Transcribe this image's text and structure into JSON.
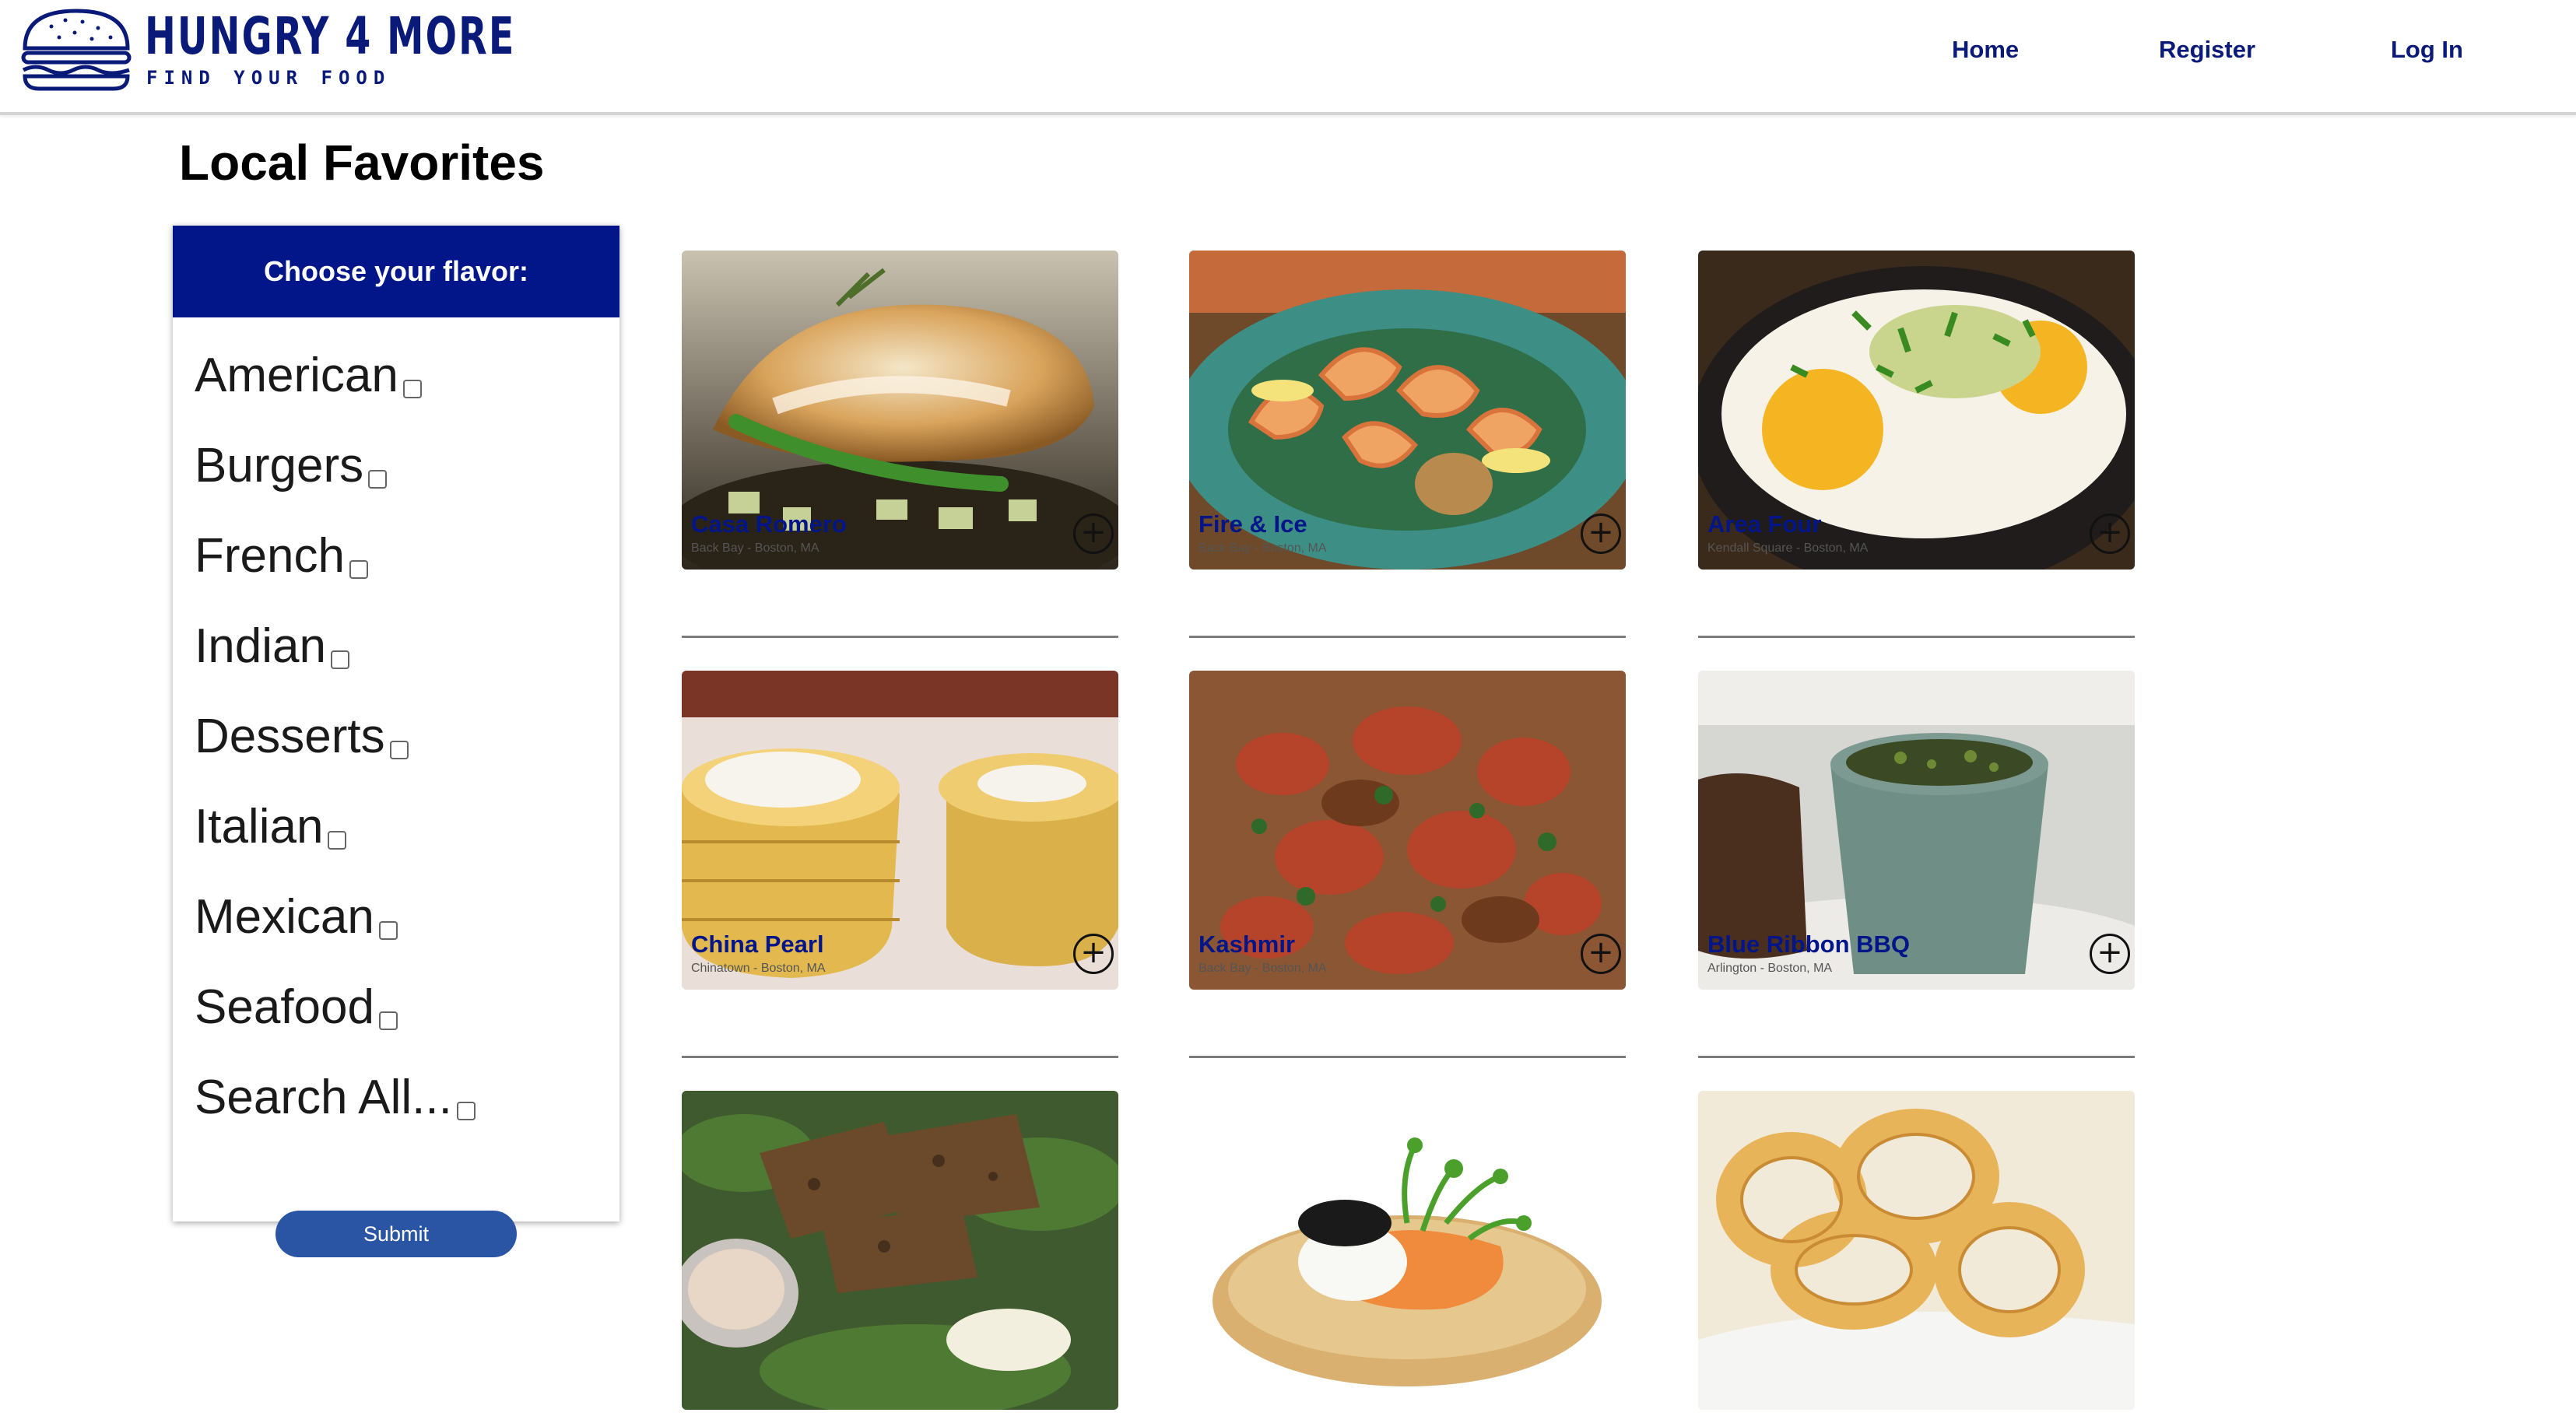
{
  "brand": {
    "title": "HUNGRY 4 MORE",
    "subtitle": "FIND YOUR FOOD",
    "icon": "burger-icon",
    "color": "#0a1a78"
  },
  "nav": {
    "home": "Home",
    "register": "Register",
    "login": "Log In"
  },
  "page": {
    "title": "Local Favorites"
  },
  "filter": {
    "heading": "Choose your flavor:",
    "options": [
      {
        "label": "American",
        "checked": false
      },
      {
        "label": "Burgers",
        "checked": false
      },
      {
        "label": "French",
        "checked": false
      },
      {
        "label": "Indian",
        "checked": false
      },
      {
        "label": "Desserts",
        "checked": false
      },
      {
        "label": "Italian",
        "checked": false
      },
      {
        "label": "Mexican",
        "checked": false
      },
      {
        "label": "Seafood",
        "checked": false
      },
      {
        "label": "Search All...",
        "checked": false
      }
    ],
    "submit": "Submit",
    "header_color": "#02168a",
    "button_color": "#2a55a4"
  },
  "restaurants": [
    {
      "name": "Casa Romero",
      "location": "Back Bay - Boston, MA",
      "photo": "stuffed-chicken-photo",
      "add_icon": "plus-circle-icon"
    },
    {
      "name": "Fire & Ice",
      "location": "Back Bay - Boston, MA",
      "photo": "shrimp-plate-photo",
      "add_icon": "plus-circle-icon"
    },
    {
      "name": "Area Four",
      "location": "Kendall Square - Boston, MA",
      "photo": "eggs-skillet-photo",
      "add_icon": "plus-circle-icon"
    },
    {
      "name": "China Pearl",
      "location": "Chinatown - Boston, MA",
      "photo": "dumplings-photo",
      "add_icon": "plus-circle-icon"
    },
    {
      "name": "Kashmir",
      "location": "Back Bay - Boston, MA",
      "photo": "curry-photo",
      "add_icon": "plus-circle-icon"
    },
    {
      "name": "Blue Ribbon BBQ",
      "location": "Arlington - Boston, MA",
      "photo": "bbq-photo",
      "add_icon": "plus-circle-icon"
    },
    {
      "name": "",
      "location": "",
      "photo": "grilled-chicken-salad-photo"
    },
    {
      "name": "",
      "location": "",
      "photo": "caviar-blini-photo"
    },
    {
      "name": "",
      "location": "",
      "photo": "onion-rings-photo"
    }
  ]
}
